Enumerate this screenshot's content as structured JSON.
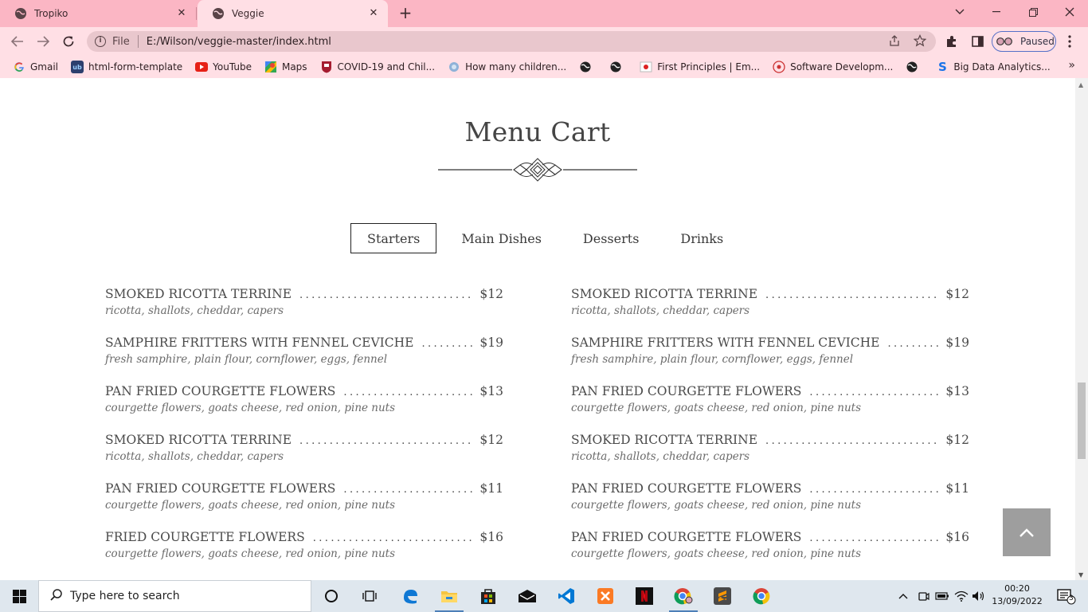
{
  "browser": {
    "tabs": [
      {
        "title": "Tropiko",
        "active": false
      },
      {
        "title": "Veggie",
        "active": true
      }
    ],
    "address": {
      "scheme": "File",
      "url": "E:/Wilson/veggie-master/index.html"
    },
    "profile_status": "Paused",
    "bookmarks": [
      {
        "label": "Gmail",
        "icon": "gmail-icon"
      },
      {
        "label": "html-form-template",
        "icon": "ub-icon"
      },
      {
        "label": "YouTube",
        "icon": "youtube-icon"
      },
      {
        "label": "Maps",
        "icon": "maps-icon"
      },
      {
        "label": "COVID-19 and Chil...",
        "icon": "harvard-icon"
      },
      {
        "label": "How many children...",
        "icon": "globe-icon"
      },
      {
        "label": "",
        "icon": "globe-icon"
      },
      {
        "label": "",
        "icon": "globe-icon"
      },
      {
        "label": "First Principles | Em...",
        "icon": "flag-icon"
      },
      {
        "label": "Software Developm...",
        "icon": "compass-icon"
      },
      {
        "label": "",
        "icon": "globe-icon"
      },
      {
        "label": "Big Data Analytics...",
        "icon": "s-icon"
      }
    ]
  },
  "page": {
    "title": "Menu Cart",
    "tabs": [
      "Starters",
      "Main Dishes",
      "Desserts",
      "Drinks"
    ],
    "active_tab": "Starters",
    "left_items": [
      {
        "name": "SMOKED RICOTTA TERRINE",
        "price": "$12",
        "desc": "ricotta, shallots, cheddar, capers"
      },
      {
        "name": "SAMPHIRE FRITTERS WITH FENNEL CEVICHE",
        "price": "$19",
        "desc": "fresh samphire, plain flour, cornflower, eggs, fennel"
      },
      {
        "name": "PAN FRIED COURGETTE FLOWERS",
        "price": "$13",
        "desc": "courgette flowers, goats cheese, red onion, pine nuts"
      },
      {
        "name": "SMOKED RICOTTA TERRINE",
        "price": "$12",
        "desc": "ricotta, shallots, cheddar, capers"
      },
      {
        "name": "PAN FRIED COURGETTE FLOWERS",
        "price": "$11",
        "desc": "courgette flowers, goats cheese, red onion, pine nuts"
      },
      {
        "name": "FRIED COURGETTE FLOWERS",
        "price": "$16",
        "desc": "courgette flowers, goats cheese, red onion, pine nuts"
      }
    ],
    "right_items": [
      {
        "name": "SMOKED RICOTTA TERRINE",
        "price": "$12",
        "desc": "ricotta, shallots, cheddar, capers"
      },
      {
        "name": "SAMPHIRE FRITTERS WITH FENNEL CEVICHE",
        "price": "$19",
        "desc": "fresh samphire, plain flour, cornflower, eggs, fennel"
      },
      {
        "name": "PAN FRIED COURGETTE FLOWERS",
        "price": "$13",
        "desc": "courgette flowers, goats cheese, red onion, pine nuts"
      },
      {
        "name": "SMOKED RICOTTA TERRINE",
        "price": "$12",
        "desc": "ricotta, shallots, cheddar, capers"
      },
      {
        "name": "PAN FRIED COURGETTE FLOWERS",
        "price": "$11",
        "desc": "courgette flowers, goats cheese, red onion, pine nuts"
      },
      {
        "name": "PAN FRIED COURGETTE FLOWERS",
        "price": "$16",
        "desc": "courgette flowers, goats cheese, red onion, pine nuts"
      }
    ]
  },
  "taskbar": {
    "search_placeholder": "Type here to search",
    "time": "00:20",
    "date": "13/09/2022",
    "notifications": "3"
  },
  "colors": {
    "tabbar": "#fbb6c4",
    "toolbar": "#ffdfe5",
    "back_to_top": "#9e9e9e"
  }
}
